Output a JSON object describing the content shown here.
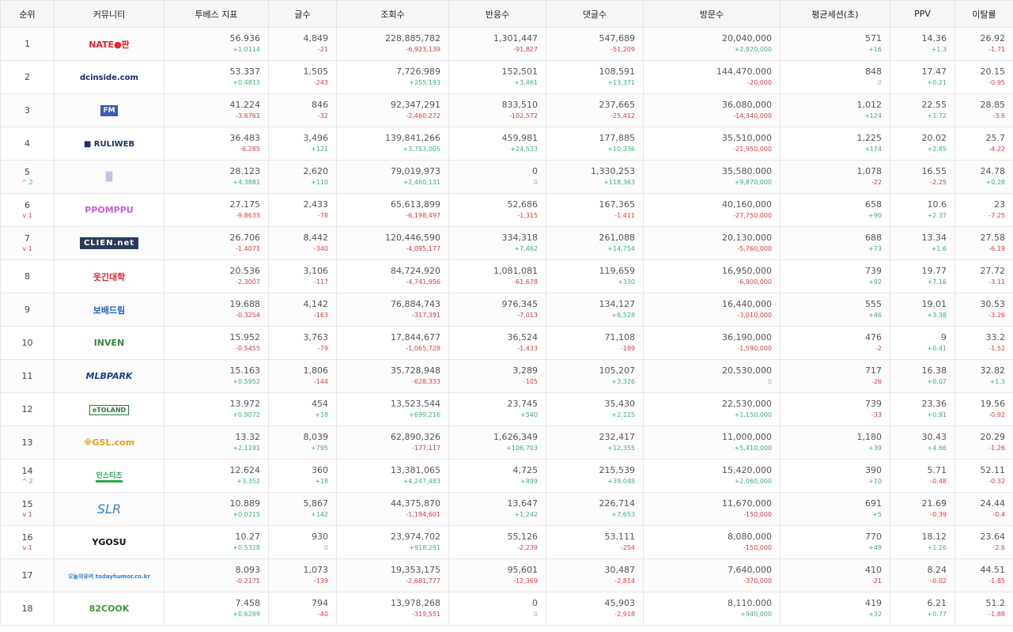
{
  "headers": [
    "순위",
    "커뮤니티",
    "투베스 지표",
    "글수",
    "조회수",
    "반응수",
    "댓글수",
    "방문수",
    "평균세션(초)",
    "PPV",
    "이탈률"
  ],
  "rows": [
    {
      "rank": "1",
      "change": "",
      "logo_icon": "nate-pann-logo",
      "logo_text": "NATE●판",
      "logo_color": "#e8232a",
      "score": "56.936",
      "score_d": "+1.0114",
      "posts": "4,849",
      "posts_d": "-21",
      "views": "228,885,782",
      "views_d": "-6,923,139",
      "reactions": "1,301,447",
      "reactions_d": "-91,827",
      "comments": "547,689",
      "comments_d": "-51,209",
      "visits": "20,040,000",
      "visits_d": "+2,920,000",
      "session": "571",
      "session_d": "+16",
      "ppv": "14.36",
      "ppv_d": "+1.3",
      "bounce": "26.92",
      "bounce_d": "-1.71"
    },
    {
      "rank": "2",
      "change": "",
      "logo_icon": "dcinside-logo",
      "logo_text": "dcinside.com",
      "logo_color": "#1b2a6b",
      "score": "53.337",
      "score_d": "+0.4813",
      "posts": "1,505",
      "posts_d": "-243",
      "views": "7,726,989",
      "views_d": "+255,193",
      "reactions": "152,501",
      "reactions_d": "+3,461",
      "comments": "108,591",
      "comments_d": "+13,371",
      "visits": "144,470,000",
      "visits_d": "-20,000",
      "session": "848",
      "session_d": "0",
      "ppv": "17.47",
      "ppv_d": "+0.21",
      "bounce": "20.15",
      "bounce_d": "-0.95"
    },
    {
      "rank": "3",
      "change": "",
      "logo_icon": "fmkorea-logo",
      "logo_text": "FM",
      "logo_color": "#3b5bb5",
      "score": "41.224",
      "score_d": "-3.6761",
      "posts": "846",
      "posts_d": "-32",
      "views": "92,347,291",
      "views_d": "-2,460,272",
      "reactions": "833,510",
      "reactions_d": "-102,572",
      "comments": "237,665",
      "comments_d": "-25,412",
      "visits": "36,080,000",
      "visits_d": "-14,340,000",
      "session": "1,012",
      "session_d": "+124",
      "ppv": "22.55",
      "ppv_d": "+1.72",
      "bounce": "28.85",
      "bounce_d": "-3.6"
    },
    {
      "rank": "4",
      "change": "",
      "logo_icon": "ruliweb-logo",
      "logo_text": "■ RULIWEB",
      "logo_color": "#1a2f6b",
      "score": "36.483",
      "score_d": "-6.285",
      "posts": "3,496",
      "posts_d": "+121",
      "views": "139,841,266",
      "views_d": "+3,753,005",
      "reactions": "459,981",
      "reactions_d": "+24,533",
      "comments": "177,885",
      "comments_d": "+10,336",
      "visits": "35,510,000",
      "visits_d": "-21,950,000",
      "session": "1,225",
      "session_d": "+174",
      "ppv": "20.02",
      "ppv_d": "+2.85",
      "bounce": "25.7",
      "bounce_d": "-4.22"
    },
    {
      "rank": "5",
      "change": "^ 2",
      "logo_icon": "theqoo-logo",
      "logo_text": "▒",
      "logo_color": "#8a8ad8",
      "score": "28.123",
      "score_d": "+4.3881",
      "posts": "2,620",
      "posts_d": "+110",
      "views": "79,019,973",
      "views_d": "+2,460,131",
      "reactions": "0",
      "reactions_d": "0",
      "comments": "1,330,253",
      "comments_d": "+118,363",
      "visits": "35,580,000",
      "visits_d": "+9,870,000",
      "session": "1,078",
      "session_d": "-22",
      "ppv": "16.55",
      "ppv_d": "-2.25",
      "bounce": "24.78",
      "bounce_d": "+0.28"
    },
    {
      "rank": "6",
      "change": "v 1",
      "logo_icon": "ppomppu-logo",
      "logo_text": "PPOMPPU",
      "logo_color": "#c75fd0",
      "score": "27.175",
      "score_d": "-9.8633",
      "posts": "2,433",
      "posts_d": "-78",
      "views": "65,613,899",
      "views_d": "-6,198,497",
      "reactions": "52,686",
      "reactions_d": "-1,315",
      "comments": "167,365",
      "comments_d": "-1,411",
      "visits": "40,160,000",
      "visits_d": "-27,750,000",
      "session": "658",
      "session_d": "+90",
      "ppv": "10.6",
      "ppv_d": "+2.37",
      "bounce": "23",
      "bounce_d": "-7.25"
    },
    {
      "rank": "7",
      "change": "v 1",
      "logo_icon": "clien-logo",
      "logo_text": "CLIEN.net",
      "logo_color": "#2b3a5c",
      "score": "26.706",
      "score_d": "-1.4071",
      "posts": "8,442",
      "posts_d": "-340",
      "views": "120,446,590",
      "views_d": "-4,095,177",
      "reactions": "334,318",
      "reactions_d": "+7,462",
      "comments": "261,088",
      "comments_d": "+14,754",
      "visits": "20,130,000",
      "visits_d": "-5,760,000",
      "session": "688",
      "session_d": "+73",
      "ppv": "13.34",
      "ppv_d": "+1.6",
      "bounce": "27.58",
      "bounce_d": "-6.19"
    },
    {
      "rank": "8",
      "change": "",
      "logo_icon": "humoruniv-logo",
      "logo_text": "웃긴대학",
      "logo_color": "#d9262c",
      "score": "20.536",
      "score_d": "-2.3007",
      "posts": "3,106",
      "posts_d": "-117",
      "views": "84,724,920",
      "views_d": "-4,741,956",
      "reactions": "1,081,081",
      "reactions_d": "-61,678",
      "comments": "119,659",
      "comments_d": "+330",
      "visits": "16,950,000",
      "visits_d": "-6,900,000",
      "session": "739",
      "session_d": "+92",
      "ppv": "19.77",
      "ppv_d": "+7.16",
      "bounce": "27.72",
      "bounce_d": "-3.11"
    },
    {
      "rank": "9",
      "change": "",
      "logo_icon": "bobaedream-logo",
      "logo_text": "보배드림",
      "logo_color": "#1f5fbf",
      "score": "19.688",
      "score_d": "-0.3254",
      "posts": "4,142",
      "posts_d": "-163",
      "views": "76,884,743",
      "views_d": "-317,391",
      "reactions": "976,345",
      "reactions_d": "-7,013",
      "comments": "134,127",
      "comments_d": "+6,528",
      "visits": "16,440,000",
      "visits_d": "-3,010,000",
      "session": "555",
      "session_d": "+46",
      "ppv": "19.01",
      "ppv_d": "+3.38",
      "bounce": "30.53",
      "bounce_d": "-3.26"
    },
    {
      "rank": "10",
      "change": "",
      "logo_icon": "inven-logo",
      "logo_text": "INVEN",
      "logo_color": "#2e8b3a",
      "score": "15.952",
      "score_d": "-0.5455",
      "posts": "3,763",
      "posts_d": "-79",
      "views": "17,844,677",
      "views_d": "-1,065,728",
      "reactions": "36,524",
      "reactions_d": "-1,433",
      "comments": "71,108",
      "comments_d": "-189",
      "visits": "36,190,000",
      "visits_d": "-1,590,000",
      "session": "476",
      "session_d": "-2",
      "ppv": "9",
      "ppv_d": "+0.41",
      "bounce": "33.2",
      "bounce_d": "-1.52"
    },
    {
      "rank": "11",
      "change": "",
      "logo_icon": "mlbpark-logo",
      "logo_text": "MLBPARK",
      "logo_color": "#1a3e8c",
      "score": "15.163",
      "score_d": "+0.5952",
      "posts": "1,806",
      "posts_d": "-144",
      "views": "35,728,948",
      "views_d": "-628,333",
      "reactions": "3,289",
      "reactions_d": "-105",
      "comments": "105,207",
      "comments_d": "+3,326",
      "visits": "20,530,000",
      "visits_d": "0",
      "session": "717",
      "session_d": "-26",
      "ppv": "16.38",
      "ppv_d": "+0.07",
      "bounce": "32.82",
      "bounce_d": "+1.3"
    },
    {
      "rank": "12",
      "change": "",
      "logo_icon": "etoland-logo",
      "logo_text": "eTOLAND",
      "logo_color": "#2a7d3a",
      "score": "13.972",
      "score_d": "+0.9072",
      "posts": "454",
      "posts_d": "+18",
      "views": "13,523,544",
      "views_d": "+699,216",
      "reactions": "23,745",
      "reactions_d": "+540",
      "comments": "35,430",
      "comments_d": "+2,125",
      "visits": "22,530,000",
      "visits_d": "+1,150,000",
      "session": "739",
      "session_d": "-33",
      "ppv": "23.36",
      "ppv_d": "+0.91",
      "bounce": "19.56",
      "bounce_d": "-0.92"
    },
    {
      "rank": "13",
      "change": "",
      "logo_icon": "gasengi-logo",
      "logo_text": "※GSL.com",
      "logo_color": "#e0a21c",
      "score": "13.32",
      "score_d": "+2.1191",
      "posts": "8,039",
      "posts_d": "+795",
      "views": "62,890,326",
      "views_d": "-177,117",
      "reactions": "1,626,349",
      "reactions_d": "+106,703",
      "comments": "232,417",
      "comments_d": "+12,355",
      "visits": "11,000,000",
      "visits_d": "+5,410,000",
      "session": "1,180",
      "session_d": "+39",
      "ppv": "30.43",
      "ppv_d": "+4.66",
      "bounce": "20.29",
      "bounce_d": "-1.26"
    },
    {
      "rank": "14",
      "change": "^ 2",
      "logo_icon": "instiz-logo",
      "logo_text": "인스티즈",
      "logo_color": "#2aa84a",
      "score": "12.624",
      "score_d": "+3.352",
      "posts": "360",
      "posts_d": "+18",
      "views": "13,381,065",
      "views_d": "+4,247,483",
      "reactions": "4,725",
      "reactions_d": "+899",
      "comments": "215,539",
      "comments_d": "+39,048",
      "visits": "15,420,000",
      "visits_d": "+2,060,000",
      "session": "390",
      "session_d": "+10",
      "ppv": "5.71",
      "ppv_d": "-0.48",
      "bounce": "52.11",
      "bounce_d": "-0.32"
    },
    {
      "rank": "15",
      "change": "v 1",
      "logo_icon": "slr-logo",
      "logo_text": "SLR",
      "logo_color": "#3a7fc4",
      "score": "10.889",
      "score_d": "+0.0215",
      "posts": "5,867",
      "posts_d": "+142",
      "views": "44,375,870",
      "views_d": "-1,194,601",
      "reactions": "13,647",
      "reactions_d": "+1,242",
      "comments": "226,714",
      "comments_d": "+7,653",
      "visits": "11,670,000",
      "visits_d": "-150,000",
      "session": "691",
      "session_d": "+5",
      "ppv": "21.69",
      "ppv_d": "-0.39",
      "bounce": "24.44",
      "bounce_d": "-0.4"
    },
    {
      "rank": "16",
      "change": "v 1",
      "logo_icon": "ygosu-logo",
      "logo_text": "YGOSU",
      "logo_color": "#111111",
      "score": "10.27",
      "score_d": "+0.5328",
      "posts": "930",
      "posts_d": "0",
      "views": "23,974,702",
      "views_d": "+918,291",
      "reactions": "55,126",
      "reactions_d": "-2,239",
      "comments": "53,111",
      "comments_d": "-254",
      "visits": "8,080,000",
      "visits_d": "-150,000",
      "session": "770",
      "session_d": "+49",
      "ppv": "18.12",
      "ppv_d": "+1.26",
      "bounce": "23.64",
      "bounce_d": "-2.6"
    },
    {
      "rank": "17",
      "change": "",
      "logo_icon": "todayhumor-logo",
      "logo_text": "오늘의유머 todayhumor.co.kr",
      "logo_color": "#2f7fd0",
      "score": "8.093",
      "score_d": "-0.2171",
      "posts": "1,073",
      "posts_d": "-139",
      "views": "19,353,175",
      "views_d": "-2,681,777",
      "reactions": "95,601",
      "reactions_d": "-12,369",
      "comments": "30,487",
      "comments_d": "-2,814",
      "visits": "7,640,000",
      "visits_d": "-370,000",
      "session": "410",
      "session_d": "-21",
      "ppv": "8.24",
      "ppv_d": "-0.02",
      "bounce": "44.51",
      "bounce_d": "-1.85"
    },
    {
      "rank": "18",
      "change": "",
      "logo_icon": "82cook-logo",
      "logo_text": "82COOK",
      "logo_color": "#3a9a3a",
      "score": "7.458",
      "score_d": "+0.6289",
      "posts": "794",
      "posts_d": "-40",
      "views": "13,978,268",
      "views_d": "-319,551",
      "reactions": "0",
      "reactions_d": "0",
      "comments": "45,903",
      "comments_d": "-2,918",
      "visits": "8,110,000",
      "visits_d": "+940,000",
      "session": "419",
      "session_d": "+32",
      "ppv": "6.21",
      "ppv_d": "+0.77",
      "bounce": "51.2",
      "bounce_d": "-1.88"
    }
  ]
}
